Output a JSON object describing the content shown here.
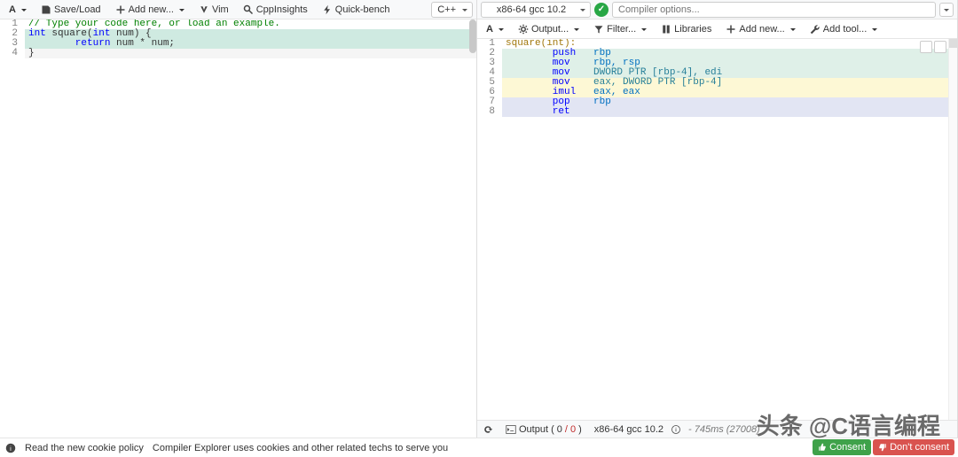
{
  "left": {
    "toolbar": {
      "font_label": "A",
      "save_load": "Save/Load",
      "add_new": "Add new...",
      "vim": "Vim",
      "cppinsights": "CppInsights",
      "quickbench": "Quick-bench"
    },
    "language": "C++",
    "code": {
      "l1": "// Type your code here, or load an example.",
      "l2a": "int",
      "l2b": " square(",
      "l2c": "int",
      "l2d": " num) {",
      "l3a": "        return",
      "l3b": " num * num;",
      "l4": "}"
    },
    "lines": [
      "1",
      "2",
      "3",
      "4"
    ]
  },
  "right": {
    "compiler": "x86-64 gcc 10.2",
    "options_placeholder": "Compiler options...",
    "toolbar": {
      "font_label": "A",
      "output": "Output...",
      "filter": "Filter...",
      "libraries": "Libraries",
      "add_new": "Add new...",
      "add_tool": "Add tool..."
    },
    "lines": [
      "1",
      "2",
      "3",
      "4",
      "5",
      "6",
      "7",
      "8"
    ],
    "asm": {
      "l1": "square(int):",
      "l2a": "        push",
      "l2b": "   rbp",
      "l3a": "        mov",
      "l3b": "    rbp, rsp",
      "l4a": "        mov",
      "l4b": "    DWORD PTR [rbp-4], edi",
      "l5a": "        mov",
      "l5b": "    eax, DWORD PTR [rbp-4]",
      "l6a": "        imul",
      "l6b": "   eax, eax",
      "l7a": "        pop",
      "l7b": "    rbp",
      "l8a": "        ret"
    },
    "status": {
      "output_label": "Output (",
      "out_ok": "0",
      "out_sep": "/",
      "out_err": "0",
      "out_close": ")",
      "compiler_short": "x86-64 gcc 10.2",
      "timing": "- 745ms (27008)"
    }
  },
  "footer": {
    "cookie_link": "Read the new cookie policy",
    "cookie_msg": "Compiler Explorer uses cookies and other related techs to serve you",
    "consent": "Consent",
    "dont_consent": "Don't consent"
  },
  "watermark": "头条 @C语言编程"
}
